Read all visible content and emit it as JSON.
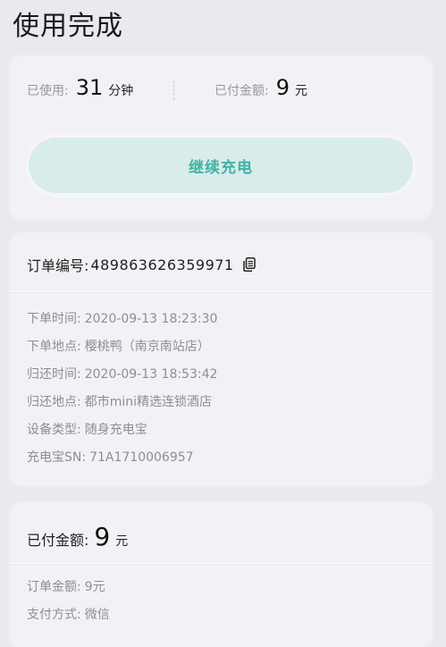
{
  "page": {
    "title": "使用完成"
  },
  "usage": {
    "used_label": "已使用:",
    "used_value": "31",
    "used_unit": "分钟",
    "paid_label": "已付金额:",
    "paid_value": "9",
    "paid_unit": "元",
    "continue_button": "继续充电"
  },
  "order": {
    "number_label": "订单编号:",
    "number_value": "489863626359971",
    "copy_icon": "copy-icon",
    "details": [
      {
        "label": "下单时间:",
        "value": "2020-09-13 18:23:30"
      },
      {
        "label": "下单地点:",
        "value": "樱桃鸭（南京南站店）"
      },
      {
        "label": "归还时间:",
        "value": "2020-09-13 18:53:42"
      },
      {
        "label": "归还地点:",
        "value": "都市mini精选连锁酒店"
      },
      {
        "label": "设备类型:",
        "value": "随身充电宝"
      },
      {
        "label": "充电宝SN:",
        "value": "71A1710006957"
      }
    ]
  },
  "payment": {
    "label": "已付金额:",
    "value": "9",
    "unit": "元",
    "details": [
      {
        "label": "订单金额:",
        "value": "9元"
      },
      {
        "label": "支付方式:",
        "value": "微信"
      }
    ]
  },
  "colors": {
    "accent": "#3fb3a5",
    "button_bg": "#d9ece9",
    "background": "#e9e9ef",
    "card_bg": "#f2f2f6"
  }
}
